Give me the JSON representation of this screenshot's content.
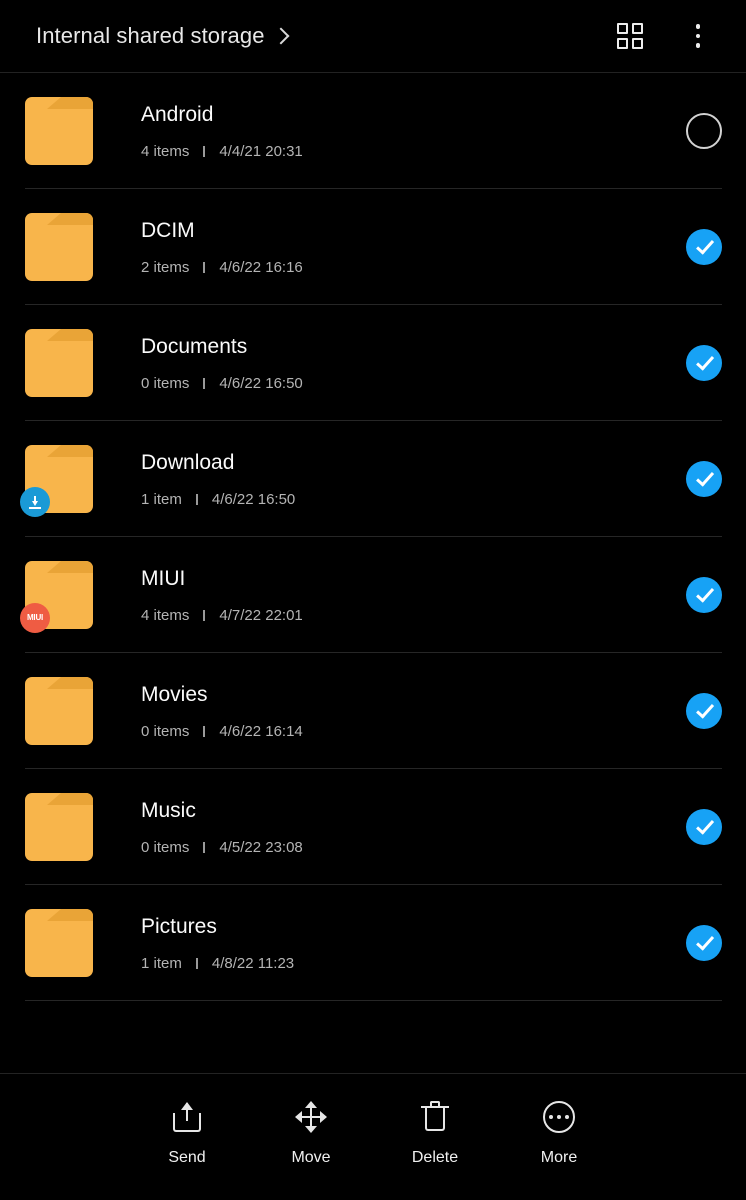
{
  "app": {
    "background_color": "#000000",
    "accent_color": "#17a2f5",
    "folder_color": "#f8b54b"
  },
  "header": {
    "breadcrumb_label": "Internal shared storage",
    "chevron_icon": "chevron-right-icon",
    "grid_view_icon": "grid-view-icon",
    "overflow_icon": "more-vertical-icon"
  },
  "list": {
    "meta_separator": "|",
    "rows": [
      {
        "name": "Android",
        "items": "4 items",
        "date": "4/4/21 20:31",
        "selected": false,
        "badge": null,
        "badge_text": ""
      },
      {
        "name": "DCIM",
        "items": "2 items",
        "date": "4/6/22 16:16",
        "selected": true,
        "badge": null,
        "badge_text": ""
      },
      {
        "name": "Documents",
        "items": "0 items",
        "date": "4/6/22 16:50",
        "selected": true,
        "badge": null,
        "badge_text": ""
      },
      {
        "name": "Download",
        "items": "1 item",
        "date": "4/6/22 16:50",
        "selected": true,
        "badge": "download-badge-icon",
        "badge_text": ""
      },
      {
        "name": "MIUI",
        "items": "4 items",
        "date": "4/7/22 22:01",
        "selected": true,
        "badge": "miui-badge-icon",
        "badge_text": "MIUI"
      },
      {
        "name": "Movies",
        "items": "0 items",
        "date": "4/6/22 16:14",
        "selected": true,
        "badge": null,
        "badge_text": ""
      },
      {
        "name": "Music",
        "items": "0 items",
        "date": "4/5/22 23:08",
        "selected": true,
        "badge": null,
        "badge_text": ""
      },
      {
        "name": "Pictures",
        "items": "1 item",
        "date": "4/8/22 11:23",
        "selected": true,
        "badge": null,
        "badge_text": ""
      }
    ]
  },
  "bottom_bar": {
    "actions": [
      {
        "label": "Send",
        "icon": "share-icon"
      },
      {
        "label": "Move",
        "icon": "move-arrows-icon"
      },
      {
        "label": "Delete",
        "icon": "trash-icon"
      },
      {
        "label": "More",
        "icon": "more-circle-icon"
      }
    ]
  }
}
